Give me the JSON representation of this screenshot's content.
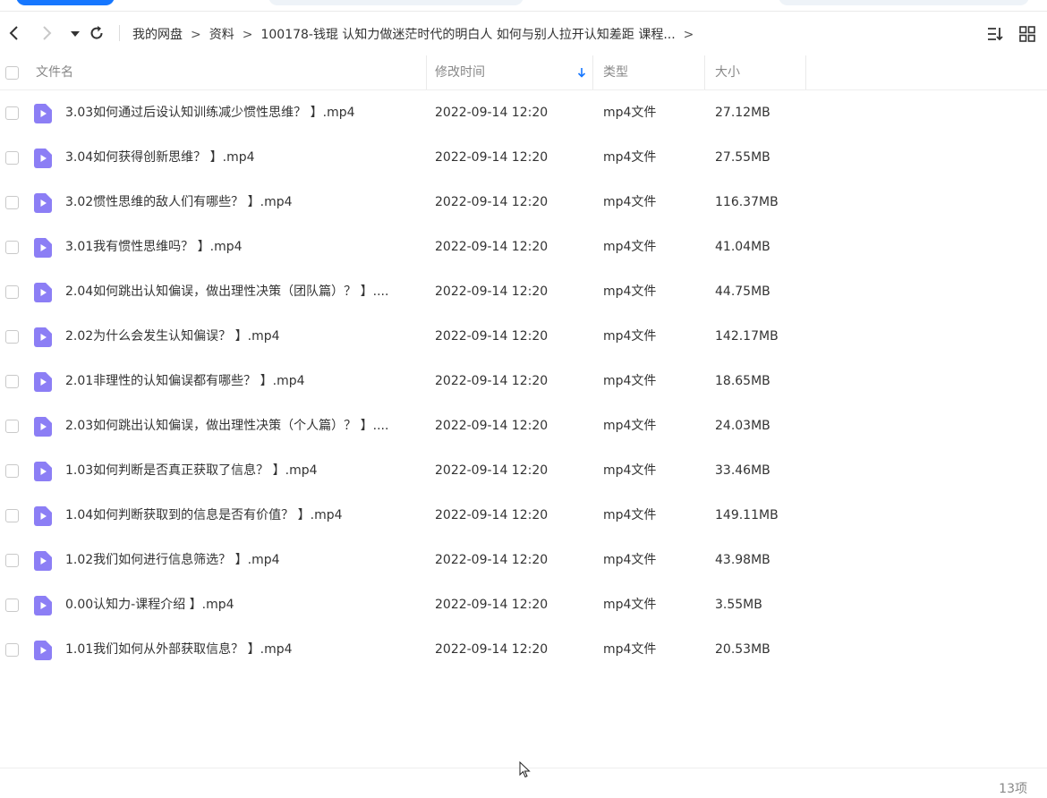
{
  "nav": {
    "breadcrumb": [
      "我的网盘",
      "资料",
      "100178-钱琨 认知力做迷茫时代的明白人 如何与别人拉开认知差距 课程..."
    ],
    "separator": ">"
  },
  "columns": {
    "name": "文件名",
    "modified": "修改时间",
    "type": "类型",
    "size": "大小"
  },
  "files": [
    {
      "name": "3.03如何通过后设认知训练减少惯性思维？ 】.mp4",
      "date": "2022-09-14 12:20",
      "type": "mp4文件",
      "size": "27.12MB"
    },
    {
      "name": "3.04如何获得创新思维？ 】.mp4",
      "date": "2022-09-14 12:20",
      "type": "mp4文件",
      "size": "27.55MB"
    },
    {
      "name": "3.02惯性思维的敌人们有哪些？ 】.mp4",
      "date": "2022-09-14 12:20",
      "type": "mp4文件",
      "size": "116.37MB"
    },
    {
      "name": "3.01我有惯性思维吗？ 】.mp4",
      "date": "2022-09-14 12:20",
      "type": "mp4文件",
      "size": "41.04MB"
    },
    {
      "name": "2.04如何跳出认知偏误，做出理性决策（团队篇）？ 】....",
      "date": "2022-09-14 12:20",
      "type": "mp4文件",
      "size": "44.75MB"
    },
    {
      "name": "2.02为什么会发生认知偏误？ 】.mp4",
      "date": "2022-09-14 12:20",
      "type": "mp4文件",
      "size": "142.17MB"
    },
    {
      "name": "2.01非理性的认知偏误都有哪些？ 】.mp4",
      "date": "2022-09-14 12:20",
      "type": "mp4文件",
      "size": "18.65MB"
    },
    {
      "name": "2.03如何跳出认知偏误，做出理性决策（个人篇）？ 】....",
      "date": "2022-09-14 12:20",
      "type": "mp4文件",
      "size": "24.03MB"
    },
    {
      "name": "1.03如何判断是否真正获取了信息？ 】.mp4",
      "date": "2022-09-14 12:20",
      "type": "mp4文件",
      "size": "33.46MB"
    },
    {
      "name": "1.04如何判断获取到的信息是否有价值？ 】.mp4",
      "date": "2022-09-14 12:20",
      "type": "mp4文件",
      "size": "149.11MB"
    },
    {
      "name": "1.02我们如何进行信息筛选？ 】.mp4",
      "date": "2022-09-14 12:20",
      "type": "mp4文件",
      "size": "43.98MB"
    },
    {
      "name": "0.00认知力-课程介绍 】.mp4",
      "date": "2022-09-14 12:20",
      "type": "mp4文件",
      "size": "3.55MB"
    },
    {
      "name": "1.01我们如何从外部获取信息？ 】.mp4",
      "date": "2022-09-14 12:20",
      "type": "mp4文件",
      "size": "20.53MB"
    }
  ],
  "footer": {
    "count": "13项"
  },
  "colors": {
    "accent": "#1677ff",
    "file_icon": "#8c7ef5"
  },
  "icons": [
    "back-icon",
    "forward-icon",
    "dropdown-icon",
    "refresh-icon",
    "sort-icon",
    "grid-view-icon",
    "sort-arrow-icon",
    "video-file-icon"
  ]
}
